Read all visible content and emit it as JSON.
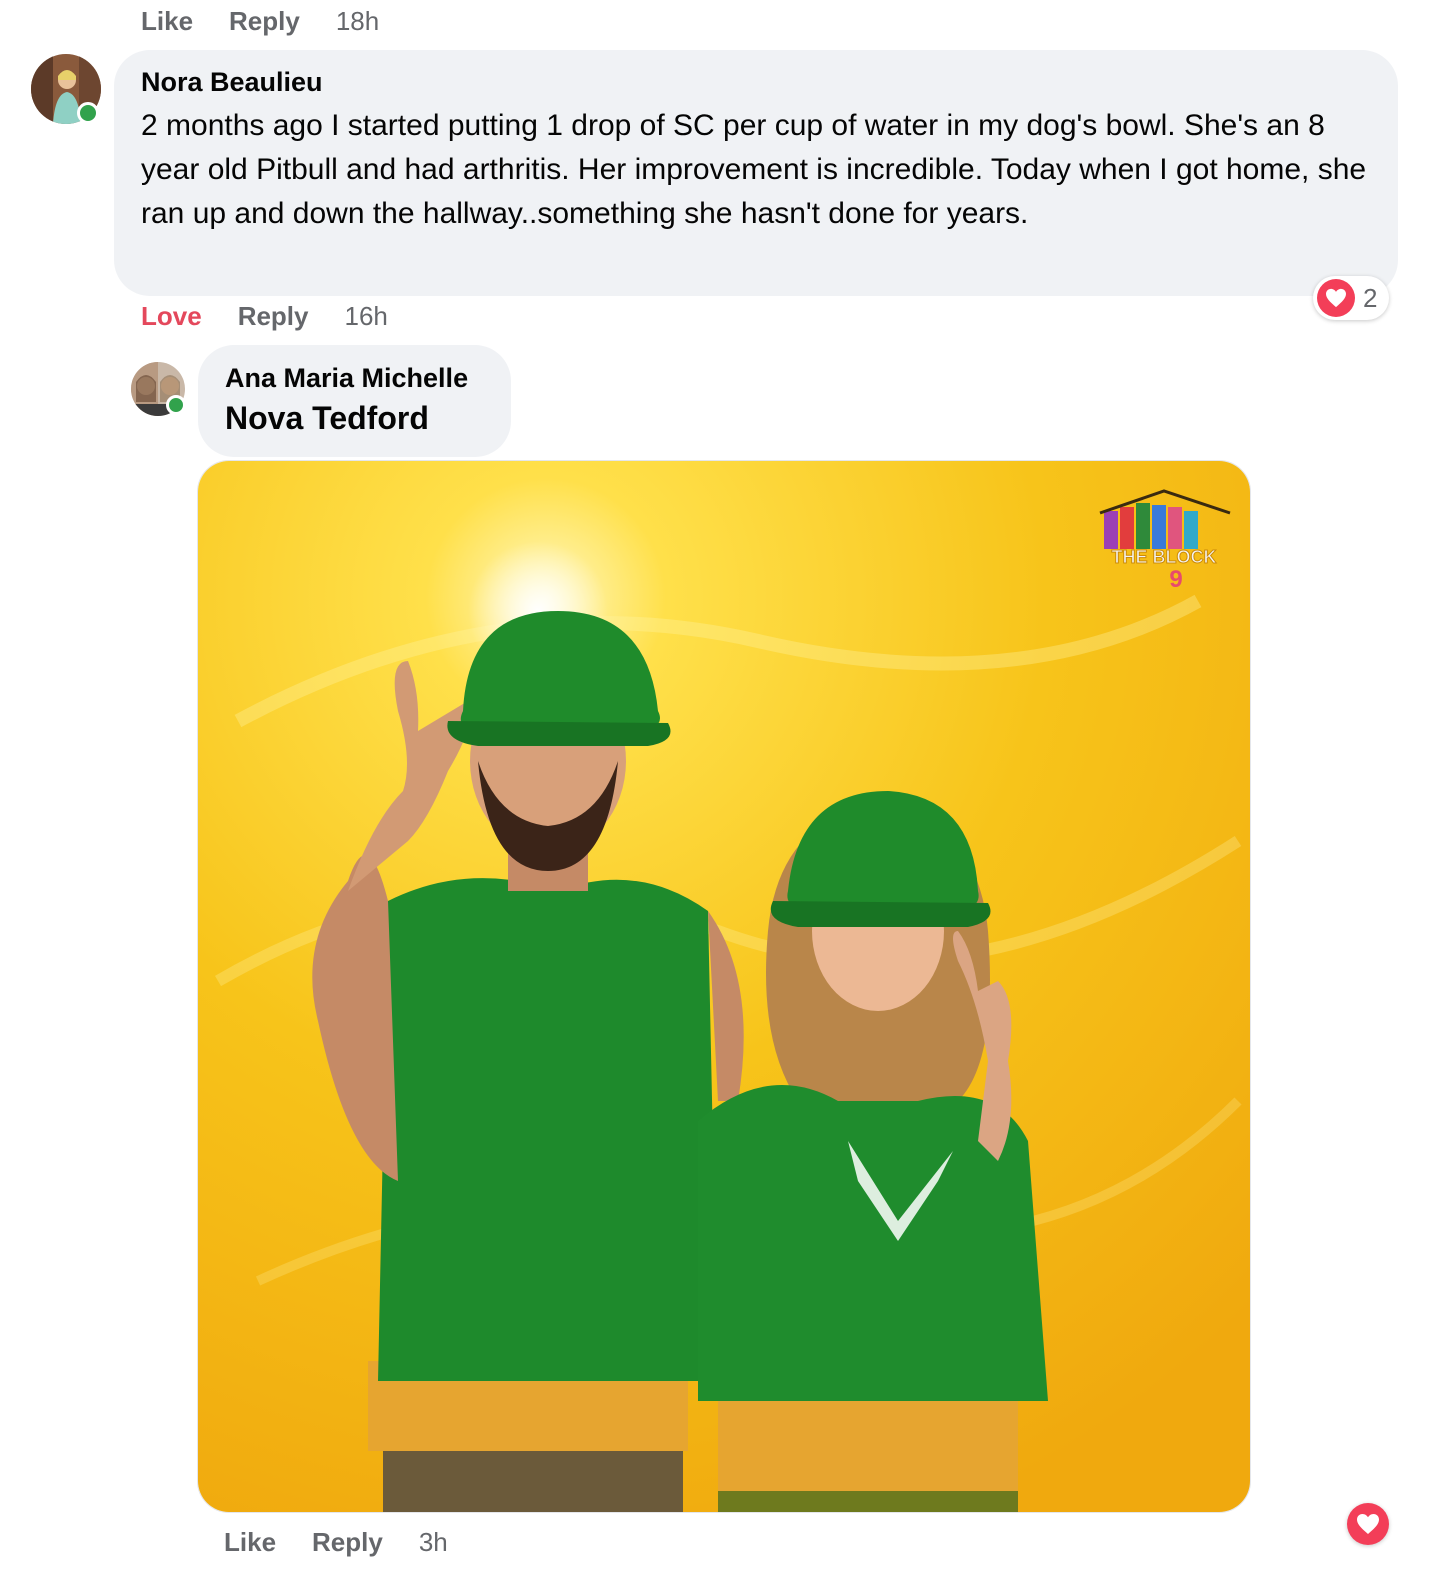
{
  "top_actions": {
    "like": "Like",
    "reply": "Reply",
    "time": "18h"
  },
  "comment1": {
    "author": "Nora Beaulieu",
    "text": "2 months ago I started putting 1 drop of SC per cup of water in my dog's bowl. She's an 8 year old Pitbull and had arthritis. Her improvement is incredible. Today when I got home, she ran up and down the hallway..something she hasn't done for years.",
    "reaction_icon": "heart-icon",
    "reaction_count": "2",
    "actions": {
      "love": "Love",
      "reply": "Reply",
      "time": "16h"
    }
  },
  "reply1": {
    "author": "Ana Maria Michelle",
    "mention": "Nova Tedford",
    "gif_logo": "THE BLOCK",
    "gif_logo_channel": "9",
    "reaction_icon": "heart-icon",
    "actions": {
      "like": "Like",
      "reply": "Reply",
      "time": "3h"
    }
  },
  "colors": {
    "love": "#e4485c",
    "meta": "#65676b",
    "bubble": "#f0f2f5",
    "online": "#31a24c",
    "heart": "#f33e58",
    "gif_bg": "#f6c512",
    "green_shirt": "#1a8a2a"
  }
}
